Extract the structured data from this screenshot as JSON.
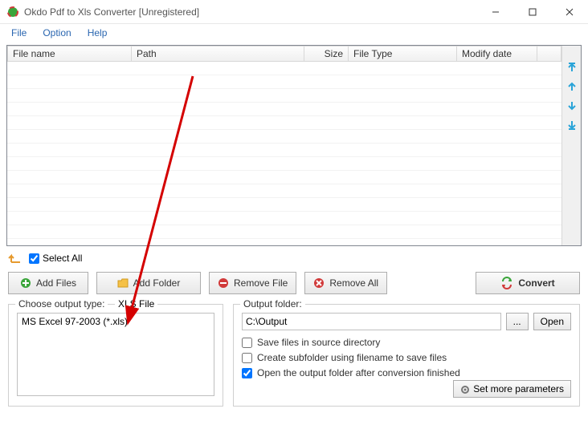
{
  "window": {
    "title": "Okdo Pdf to Xls Converter [Unregistered]"
  },
  "menu": {
    "file": "File",
    "option": "Option",
    "help": "Help"
  },
  "table": {
    "headers": {
      "filename": "File name",
      "path": "Path",
      "size": "Size",
      "filetype": "File Type",
      "modify": "Modify date"
    }
  },
  "selectall": {
    "label": "Select All"
  },
  "buttons": {
    "addfiles": "Add Files",
    "addfolder": "Add Folder",
    "removefile": "Remove File",
    "removeall": "Remove All",
    "convert": "Convert"
  },
  "outputtype": {
    "legend": "Choose output type:",
    "current": "XLS File",
    "selected": "MS Excel 97-2003 (*.xls)"
  },
  "outputfolder": {
    "legend": "Output folder:",
    "path": "C:\\Output",
    "browse": "...",
    "open": "Open",
    "save_in_source": "Save files in source directory",
    "create_subfolder": "Create subfolder using filename to save files",
    "open_after": "Open the output folder after conversion finished",
    "setmore": "Set more parameters"
  },
  "colors": {
    "arrow_blue": "#2aa4d8",
    "accent_green": "#3aa53a",
    "accent_orange": "#e69a2e",
    "accent_red": "#d13a3a"
  }
}
